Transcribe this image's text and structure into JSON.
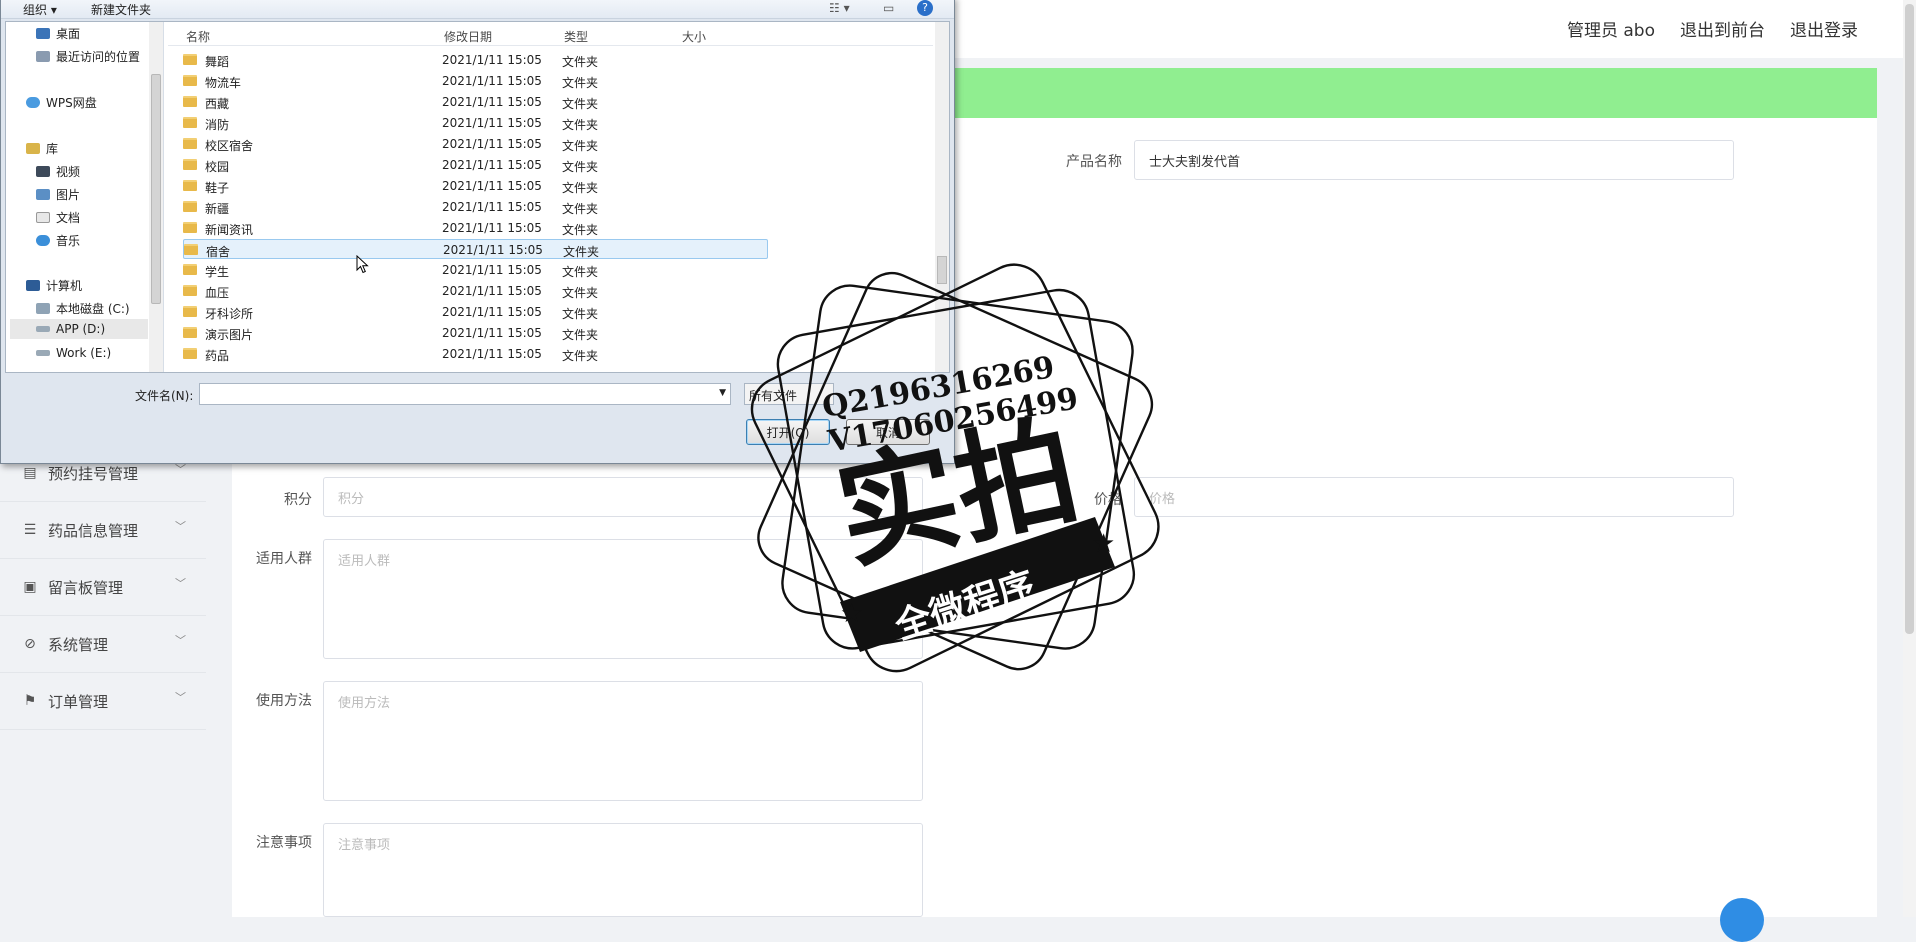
{
  "header": {
    "links": [
      "管理员 abo",
      "退出到前台",
      "退出登录"
    ]
  },
  "sidebar": {
    "items": [
      {
        "label": "预约挂号管理",
        "icon": "calendar-icon"
      },
      {
        "label": "药品信息管理",
        "icon": "list-icon"
      },
      {
        "label": "留言板管理",
        "icon": "clipboard-icon"
      },
      {
        "label": "系统管理",
        "icon": "settings-icon"
      },
      {
        "label": "订单管理",
        "icon": "flag-icon"
      }
    ]
  },
  "form": {
    "product_name_label": "产品名称",
    "product_name_value": "士大夫割发代首",
    "points_label": "积分",
    "points_placeholder": "积分",
    "price_label": "价格",
    "price_placeholder": "价格",
    "audience_label": "适用人群",
    "audience_placeholder": "适用人群",
    "usage_label": "使用方法",
    "usage_placeholder": "使用方法",
    "notes_label": "注意事项",
    "notes_placeholder": "注意事项"
  },
  "dialog": {
    "toolbar": {
      "organize": "组织 ▾",
      "new_folder": "新建文件夹"
    },
    "nav_items": [
      "桌面",
      "最近访问的位置",
      "WPS网盘",
      "库",
      "视频",
      "图片",
      "文档",
      "音乐",
      "计算机",
      "本地磁盘 (C:)",
      "APP (D:)",
      "Work (E:)"
    ],
    "columns": [
      "名称",
      "修改日期",
      "类型",
      "大小"
    ],
    "files": [
      {
        "name": "舞蹈",
        "date": "2021/1/11 15:05",
        "type": "文件夹"
      },
      {
        "name": "物流车",
        "date": "2021/1/11 15:05",
        "type": "文件夹"
      },
      {
        "name": "西藏",
        "date": "2021/1/11 15:05",
        "type": "文件夹"
      },
      {
        "name": "消防",
        "date": "2021/1/11 15:05",
        "type": "文件夹"
      },
      {
        "name": "校区宿舍",
        "date": "2021/1/11 15:05",
        "type": "文件夹"
      },
      {
        "name": "校园",
        "date": "2021/1/11 15:05",
        "type": "文件夹"
      },
      {
        "name": "鞋子",
        "date": "2021/1/11 15:05",
        "type": "文件夹"
      },
      {
        "name": "新疆",
        "date": "2021/1/11 15:05",
        "type": "文件夹"
      },
      {
        "name": "新闻资讯",
        "date": "2021/1/11 15:05",
        "type": "文件夹"
      },
      {
        "name": "宿舍",
        "date": "2021/1/11 15:05",
        "type": "文件夹"
      },
      {
        "name": "学生",
        "date": "2021/1/11 15:05",
        "type": "文件夹"
      },
      {
        "name": "血压",
        "date": "2021/1/11 15:05",
        "type": "文件夹"
      },
      {
        "name": "牙科诊所",
        "date": "2021/1/11 15:05",
        "type": "文件夹"
      },
      {
        "name": "演示图片",
        "date": "2021/1/11 15:05",
        "type": "文件夹"
      },
      {
        "name": "药品",
        "date": "2021/1/11 15:05",
        "type": "文件夹"
      }
    ],
    "filename_label": "文件名(N):",
    "filename_value": "",
    "filetype_value": "所有文件",
    "open_button": "打开(O)",
    "cancel_button": "取消"
  },
  "watermark": {
    "line1": "Q2196316269",
    "line2": "V17060256499",
    "big_text": "实拍",
    "banner": "全微程序"
  }
}
